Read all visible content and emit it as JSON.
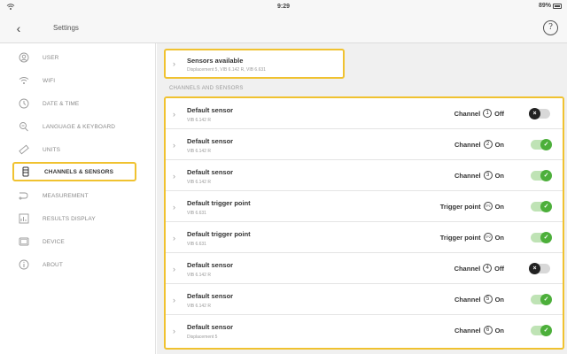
{
  "status": {
    "time": "9:29",
    "battery": "89%"
  },
  "nav": {
    "title": "Settings",
    "back_icon": "chevron-left-icon",
    "help_icon": "help-circle-icon"
  },
  "sidebar": {
    "items": [
      {
        "label": "USER",
        "icon": "user-icon"
      },
      {
        "label": "WIFI",
        "icon": "wifi-icon"
      },
      {
        "label": "DATE & TIME",
        "icon": "clock-icon"
      },
      {
        "label": "LANGUAGE & KEYBOARD",
        "icon": "language-icon"
      },
      {
        "label": "UNITS",
        "icon": "ruler-icon"
      },
      {
        "label": "CHANNELS & SENSORS",
        "icon": "sensor-icon",
        "active": true
      },
      {
        "label": "MEASUREMENT",
        "icon": "measurement-icon"
      },
      {
        "label": "RESULTS DISPLAY",
        "icon": "chart-icon"
      },
      {
        "label": "DEVICE",
        "icon": "device-icon"
      },
      {
        "label": "ABOUT",
        "icon": "info-icon"
      }
    ]
  },
  "sensors_available": {
    "title": "Sensors available",
    "subtitle": "Displacement 5, VIB 6.142 R, VIB 6.631"
  },
  "section_label": "CHANNELS AND SENSORS",
  "rows": [
    {
      "name": "Default sensor",
      "sub": "VIB 6.142 R",
      "kind": "Channel",
      "num": "1",
      "state": "Off",
      "on": false
    },
    {
      "name": "Default sensor",
      "sub": "VIB 6.142 R",
      "kind": "Channel",
      "num": "2",
      "state": "On",
      "on": true
    },
    {
      "name": "Default sensor",
      "sub": "VIB 6.142 R",
      "kind": "Channel",
      "num": "3",
      "state": "On",
      "on": true
    },
    {
      "name": "Default trigger point",
      "sub": "VIB 6.631",
      "kind": "Trigger point",
      "num": "TP1",
      "state": "On",
      "on": true
    },
    {
      "name": "Default trigger point",
      "sub": "VIB 6.631",
      "kind": "Trigger point",
      "num": "TP2",
      "state": "On",
      "on": true
    },
    {
      "name": "Default sensor",
      "sub": "VIB 6.142 R",
      "kind": "Channel",
      "num": "4",
      "state": "Off",
      "on": false
    },
    {
      "name": "Default sensor",
      "sub": "VIB 6.142 R",
      "kind": "Channel",
      "num": "5",
      "state": "On",
      "on": true
    },
    {
      "name": "Default sensor",
      "sub": "Displacement 5",
      "kind": "Channel",
      "num": "6",
      "state": "On",
      "on": true
    }
  ],
  "colors": {
    "highlight": "#f0c230",
    "toggle_on": "#4caf3a",
    "toggle_off": "#222222"
  }
}
